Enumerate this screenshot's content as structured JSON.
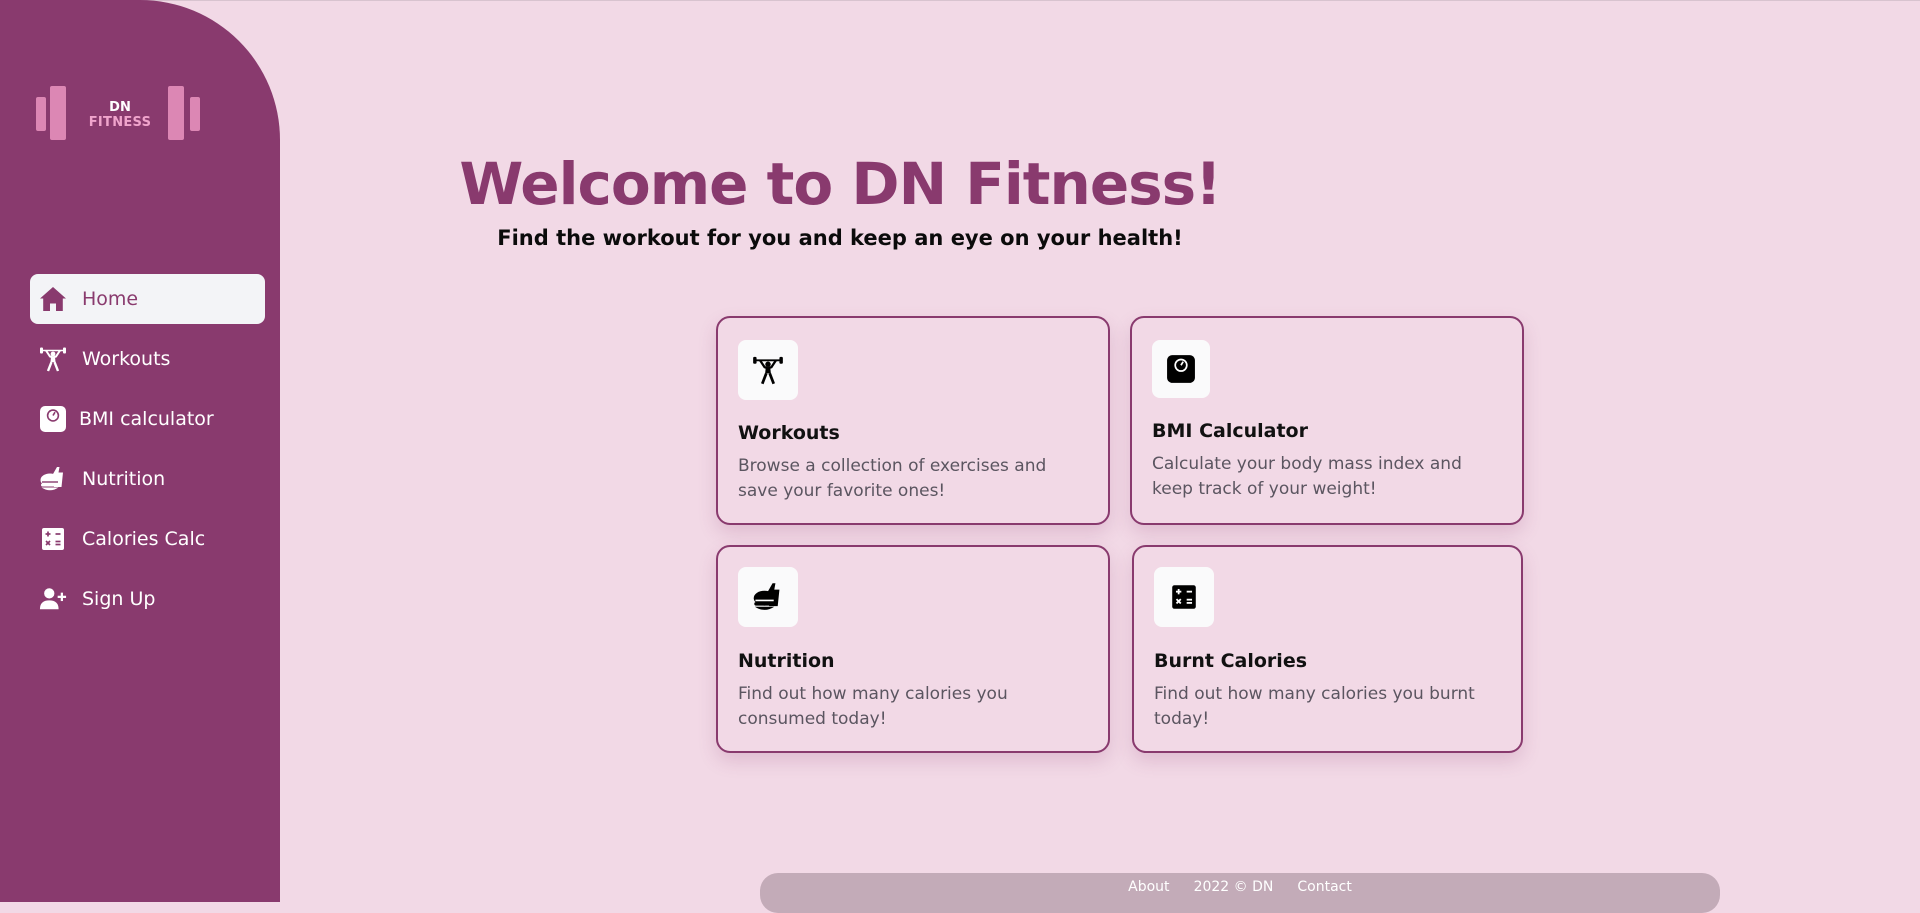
{
  "brand": {
    "line1": "DN",
    "line2": "FITNESS",
    "colors": {
      "primary": "#893a6e",
      "background": "#f2d9e6",
      "logo_accent": "#dc87b4"
    }
  },
  "sidebar": {
    "items": [
      {
        "label": "Home",
        "icon": "home-icon",
        "active": true
      },
      {
        "label": "Workouts",
        "icon": "weightlifter-icon"
      },
      {
        "label": "BMI calculator",
        "icon": "scale-icon"
      },
      {
        "label": "Nutrition",
        "icon": "food-icon"
      },
      {
        "label": "Calories Calc",
        "icon": "calculator-icon"
      },
      {
        "label": "Sign Up",
        "icon": "user-plus-icon"
      }
    ]
  },
  "hero": {
    "title": "Welcome to DN Fitness!",
    "subtitle": "Find the workout for you and keep an eye on your health!"
  },
  "cards": [
    {
      "title": "Workouts",
      "description": "Browse a collection of exercises and save your favorite ones!",
      "icon": "weightlifter-icon"
    },
    {
      "title": "BMI Calculator",
      "description": "Calculate your body mass index and keep track of your weight!",
      "icon": "scale-icon"
    },
    {
      "title": "Nutrition",
      "description": "Find out how many calories you consumed today!",
      "icon": "food-icon"
    },
    {
      "title": "Burnt Calories",
      "description": "Find out how many calories you burnt today!",
      "icon": "calculator-icon"
    }
  ],
  "footer": {
    "about": "About",
    "copyright": "2022 © DN",
    "contact": "Contact"
  }
}
